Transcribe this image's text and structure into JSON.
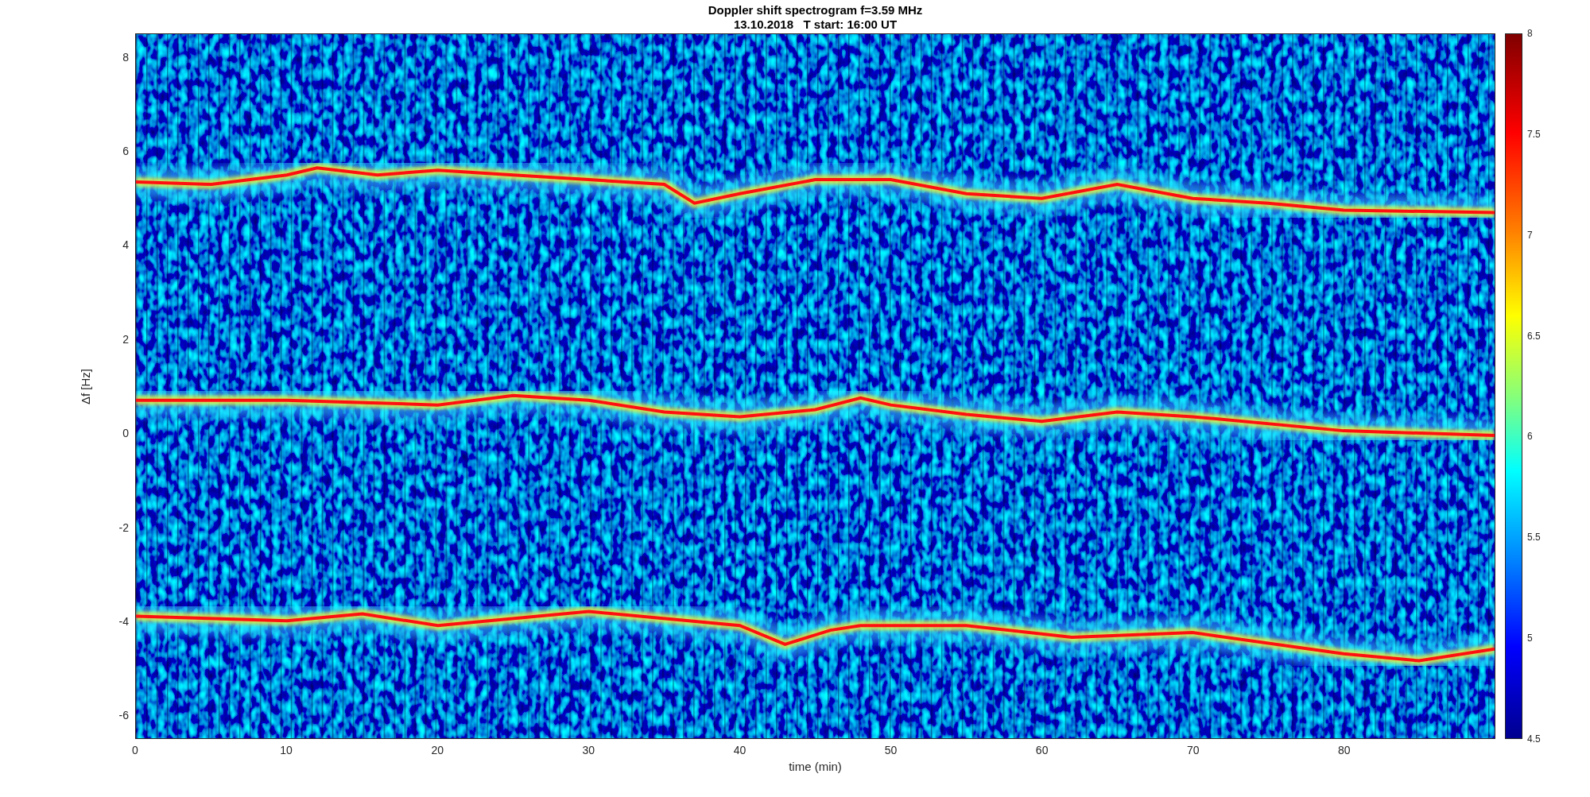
{
  "title": {
    "line_1": "Doppler shift spectrogram f=3.59 MHz",
    "line_2": "13.10.2018   T start: 16:00 UT"
  },
  "y_axis": {
    "label": "Δf [Hz]",
    "ticks": [
      "8",
      "6",
      "4",
      "2",
      "0",
      "-2",
      "-4",
      "-6"
    ]
  },
  "x_axis": {
    "label": "time (min)",
    "ticks": [
      "0",
      "10",
      "20",
      "30",
      "40",
      "50",
      "60",
      "70",
      "80"
    ]
  },
  "colorbar": {
    "ticks": [
      "8",
      "7.5",
      "7",
      "6.5",
      "6",
      "5.5",
      "5",
      "4.5"
    ]
  }
}
